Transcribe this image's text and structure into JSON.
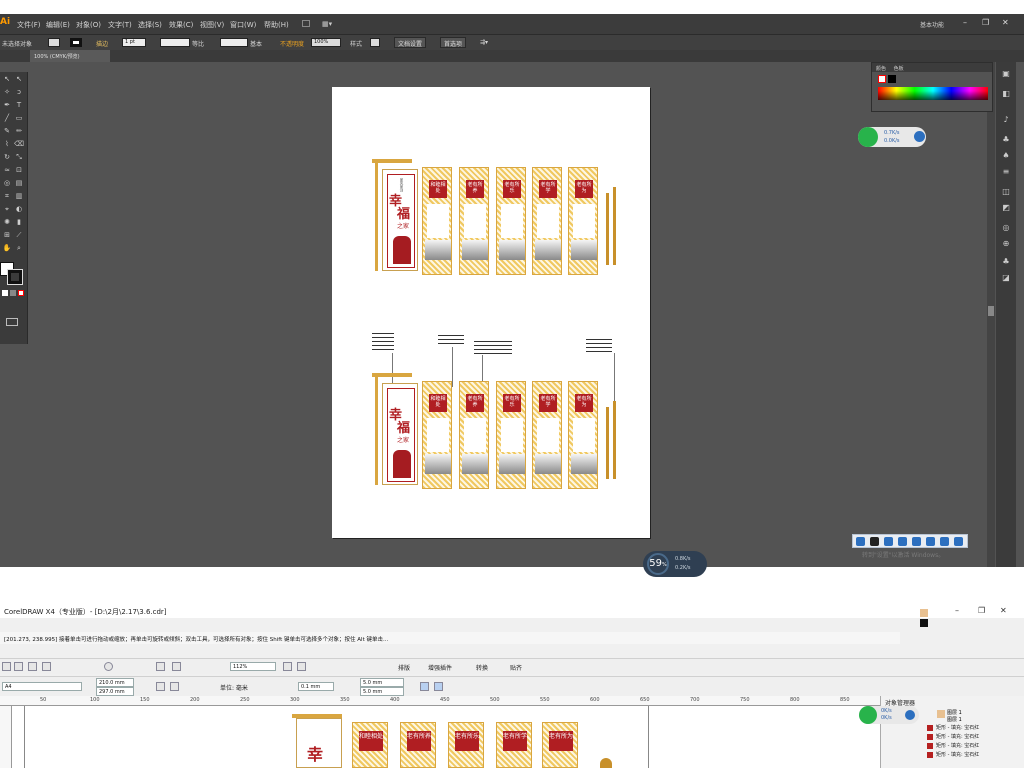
{
  "ai": {
    "logo": "Ai",
    "menu": [
      "文件(F)",
      "编辑(E)",
      "对象(O)",
      "文字(T)",
      "选择(S)",
      "效果(C)",
      "视图(V)",
      "窗口(W)",
      "帮助(H)"
    ],
    "workspace": "基本功能",
    "control": {
      "no_selection": "未选择对象",
      "stroke_label": "描边",
      "stroke_weight": "1 pt",
      "profile_label": "等比",
      "brush_label": "基本",
      "opacity_label": "不透明度",
      "opacity_value": "100%",
      "style_label": "样式",
      "doc_setup": "文档设置",
      "preferences": "首选项"
    },
    "tab": "100% (CMYK/预览)",
    "panel_tabs": [
      "颜色",
      "色板"
    ],
    "network": {
      "up": "0.7K/s",
      "down": "0.0K/s"
    },
    "speed": {
      "value": "59",
      "unit": "%",
      "up": "0.8K/s",
      "down": "0.2K/s"
    },
    "activate_text": "转到\"设置\"以激活 Windows。"
  },
  "design": {
    "main_title_1": "幸",
    "main_title_2": "福",
    "main_title_3": "之家",
    "top_label": "家风家训",
    "panels": [
      {
        "title": "和睦相处"
      },
      {
        "title": "老有所养"
      },
      {
        "title": "老有所乐"
      },
      {
        "title": "老有所学"
      },
      {
        "title": "老有所为"
      }
    ]
  },
  "cd": {
    "title": "CorelDRAW X4（专业版）- [D:\\2月\\2.17\\3.6.cdr]",
    "status": "[201.273, 238.995] 接着单击可进行拖动或缩放；再单击可旋转或倾斜；双击工具，可选择所有对象；按住 Shift 键单击可选择多个对象；按住 Alt 键单击...",
    "page_size": "A4",
    "width": "210.0 mm",
    "height": "297.0 mm",
    "unit_label": "单位: 毫米",
    "nudge": "0.1 mm",
    "dup_x": "5.0 mm",
    "dup_y": "5.0 mm",
    "zoom": "112%",
    "align": [
      "排版",
      "增强插件",
      "转换",
      "贴齐"
    ],
    "docker_title": "对象管理器",
    "layers": [
      "图层 1",
      "图层 1"
    ],
    "rows": [
      "矩形 - 填充: 宝石红",
      "矩形 - 填充: 宝石红",
      "矩形 - 填充: 宝石红",
      "矩形 - 填充: 宝石红"
    ],
    "network": {
      "up": "0K/s",
      "down": "0K/s"
    },
    "ruler": [
      "50",
      "100",
      "150",
      "200",
      "250",
      "300",
      "350",
      "400",
      "450",
      "500",
      "550",
      "600",
      "650",
      "700",
      "750",
      "800",
      "850"
    ],
    "canvas_panels": [
      {
        "title": "和睦相处"
      },
      {
        "title": "老有所养"
      },
      {
        "title": "老有所乐"
      },
      {
        "title": "老有所学"
      },
      {
        "title": "老有所为"
      }
    ]
  }
}
